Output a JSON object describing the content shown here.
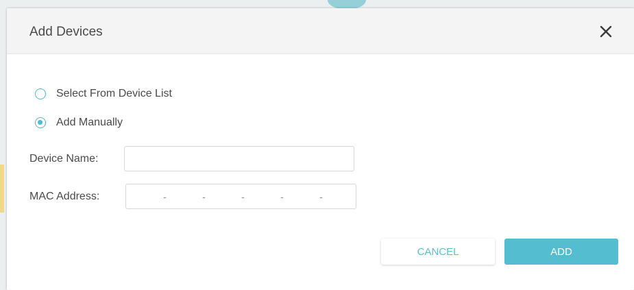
{
  "dialog": {
    "title": "Add Devices",
    "close_icon": "close-icon"
  },
  "mode": {
    "options": [
      {
        "label": "Select From Device List",
        "checked": false
      },
      {
        "label": "Add Manually",
        "checked": true
      }
    ]
  },
  "form": {
    "device_name_label": "Device Name:",
    "device_name_value": "",
    "mac_label": "MAC Address:",
    "mac_separator": "-",
    "mac_segments": [
      "",
      "",
      "",
      "",
      "",
      ""
    ]
  },
  "actions": {
    "cancel_label": "CANCEL",
    "add_label": "ADD"
  },
  "colors": {
    "accent": "#55bdd0",
    "text": "#4a4a4a"
  }
}
